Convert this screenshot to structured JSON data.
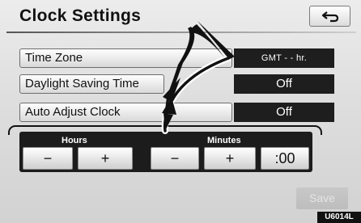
{
  "header": {
    "title": "Clock Settings",
    "back_icon": "back-arrow-icon"
  },
  "settings": [
    {
      "label": "Time Zone",
      "value": "GMT - - hr."
    },
    {
      "label": "Daylight Saving Time",
      "value": "Off"
    },
    {
      "label": "Auto Adjust Clock",
      "value": "Off"
    }
  ],
  "adjust": {
    "hours_label": "Hours",
    "minutes_label": "Minutes",
    "hours_minus": "−",
    "hours_plus": "+",
    "minutes_minus": "−",
    "minutes_plus": "+",
    "reset_label": ":00"
  },
  "footer": {
    "save_label": "Save",
    "code": "U6014L"
  },
  "colors": {
    "value_bg": "#1e1e1e",
    "panel_bg": "#1c1c1c",
    "save_disabled": "#c4c4c4"
  }
}
